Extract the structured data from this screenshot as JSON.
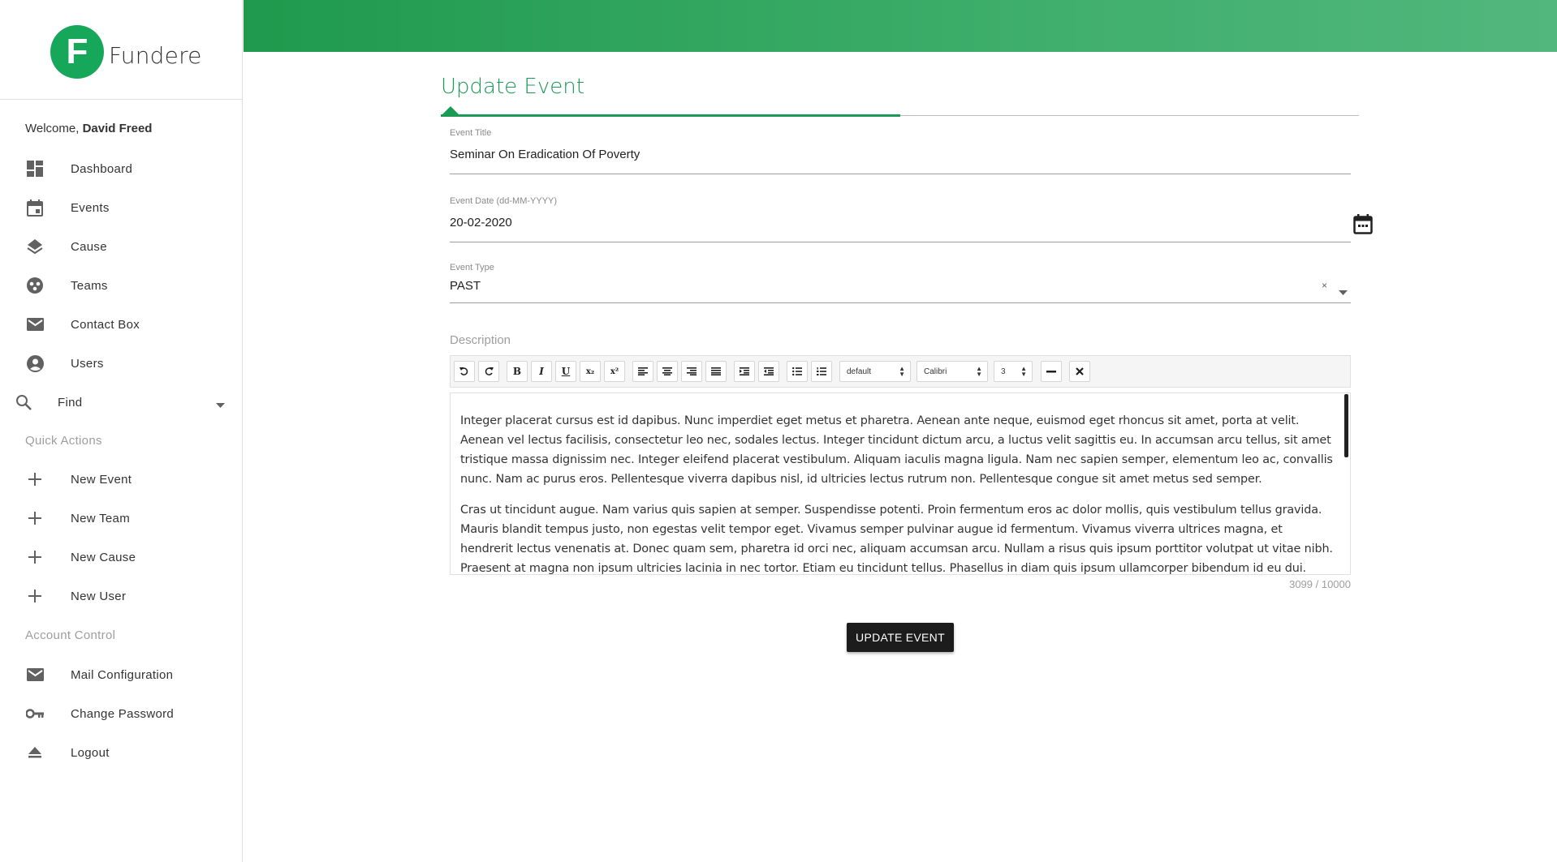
{
  "brand": {
    "logo_letter": "F",
    "name": "Fundere",
    "accent": "#17a75b"
  },
  "sidebar": {
    "welcome_prefix": "Welcome,",
    "user_name": "David Freed",
    "nav": [
      {
        "label": "Dashboard",
        "icon": "dashboard-icon"
      },
      {
        "label": "Events",
        "icon": "calendar-icon"
      },
      {
        "label": "Cause",
        "icon": "layers-icon"
      },
      {
        "label": "Teams",
        "icon": "team-icon"
      },
      {
        "label": "Contact Box",
        "icon": "mail-icon"
      },
      {
        "label": "Users",
        "icon": "account-circle-icon"
      }
    ],
    "find": {
      "label": "Find",
      "icon": "search-icon"
    },
    "quick_actions_heading": "Quick Actions",
    "quick_actions": [
      {
        "label": "New Event",
        "icon": "plus-icon"
      },
      {
        "label": "New Team",
        "icon": "plus-icon"
      },
      {
        "label": "New Cause",
        "icon": "plus-icon"
      },
      {
        "label": "New User",
        "icon": "plus-icon"
      }
    ],
    "account_heading": "Account Control",
    "account": [
      {
        "label": "Mail Configuration",
        "icon": "mail-icon"
      },
      {
        "label": "Change Password",
        "icon": "key-icon"
      },
      {
        "label": "Logout",
        "icon": "eject-icon"
      }
    ]
  },
  "form": {
    "title": "Update Event",
    "event_title": {
      "label": "Event Title",
      "value": "Seminar On Eradication Of Poverty"
    },
    "event_date": {
      "label": "Event Date (dd-MM-YYYY)",
      "value": "20-02-2020"
    },
    "event_type": {
      "label": "Event Type",
      "value": "PAST",
      "clear": "×"
    },
    "description": {
      "label": "Description",
      "toolbar": {
        "style_select": "default",
        "font_select": "Calibri",
        "size_select": "3"
      },
      "paragraphs": [
        "Integer placerat cursus est id dapibus. Nunc imperdiet eget metus et pharetra. Aenean ante neque, euismod eget rhoncus sit amet, porta at velit. Aenean vel lectus facilisis, consectetur leo nec, sodales lectus. Integer tincidunt dictum arcu, a luctus velit sagittis eu. In accumsan arcu tellus, sit amet tristique massa dignissim nec. Integer eleifend placerat vestibulum. Aliquam iaculis magna ligula. Nam nec sapien semper, elementum leo ac, convallis nunc. Nam ac purus eros. Pellentesque viverra dapibus nisl, id ultricies lectus rutrum non. Pellentesque congue sit amet metus sed semper.",
        "Cras ut tincidunt augue. Nam varius quis sapien at semper. Suspendisse potenti. Proin fermentum eros ac dolor mollis, quis vestibulum tellus gravida. Mauris blandit tempus justo, non egestas velit tempor eget. Vivamus semper pulvinar augue id fermentum. Vivamus viverra ultrices magna, et hendrerit lectus venenatis at. Donec quam sem, pharetra id orci nec, aliquam accumsan arcu. Nullam a risus quis ipsum porttitor volutpat ut vitae nibh. Praesent at magna non ipsum ultricies lacinia in nec tortor. Etiam eu tincidunt tellus. Phasellus in diam quis ipsum ullamcorper bibendum id eu dui."
      ],
      "counter": "3099 / 10000"
    },
    "submit_label": "UPDATE EVENT"
  }
}
